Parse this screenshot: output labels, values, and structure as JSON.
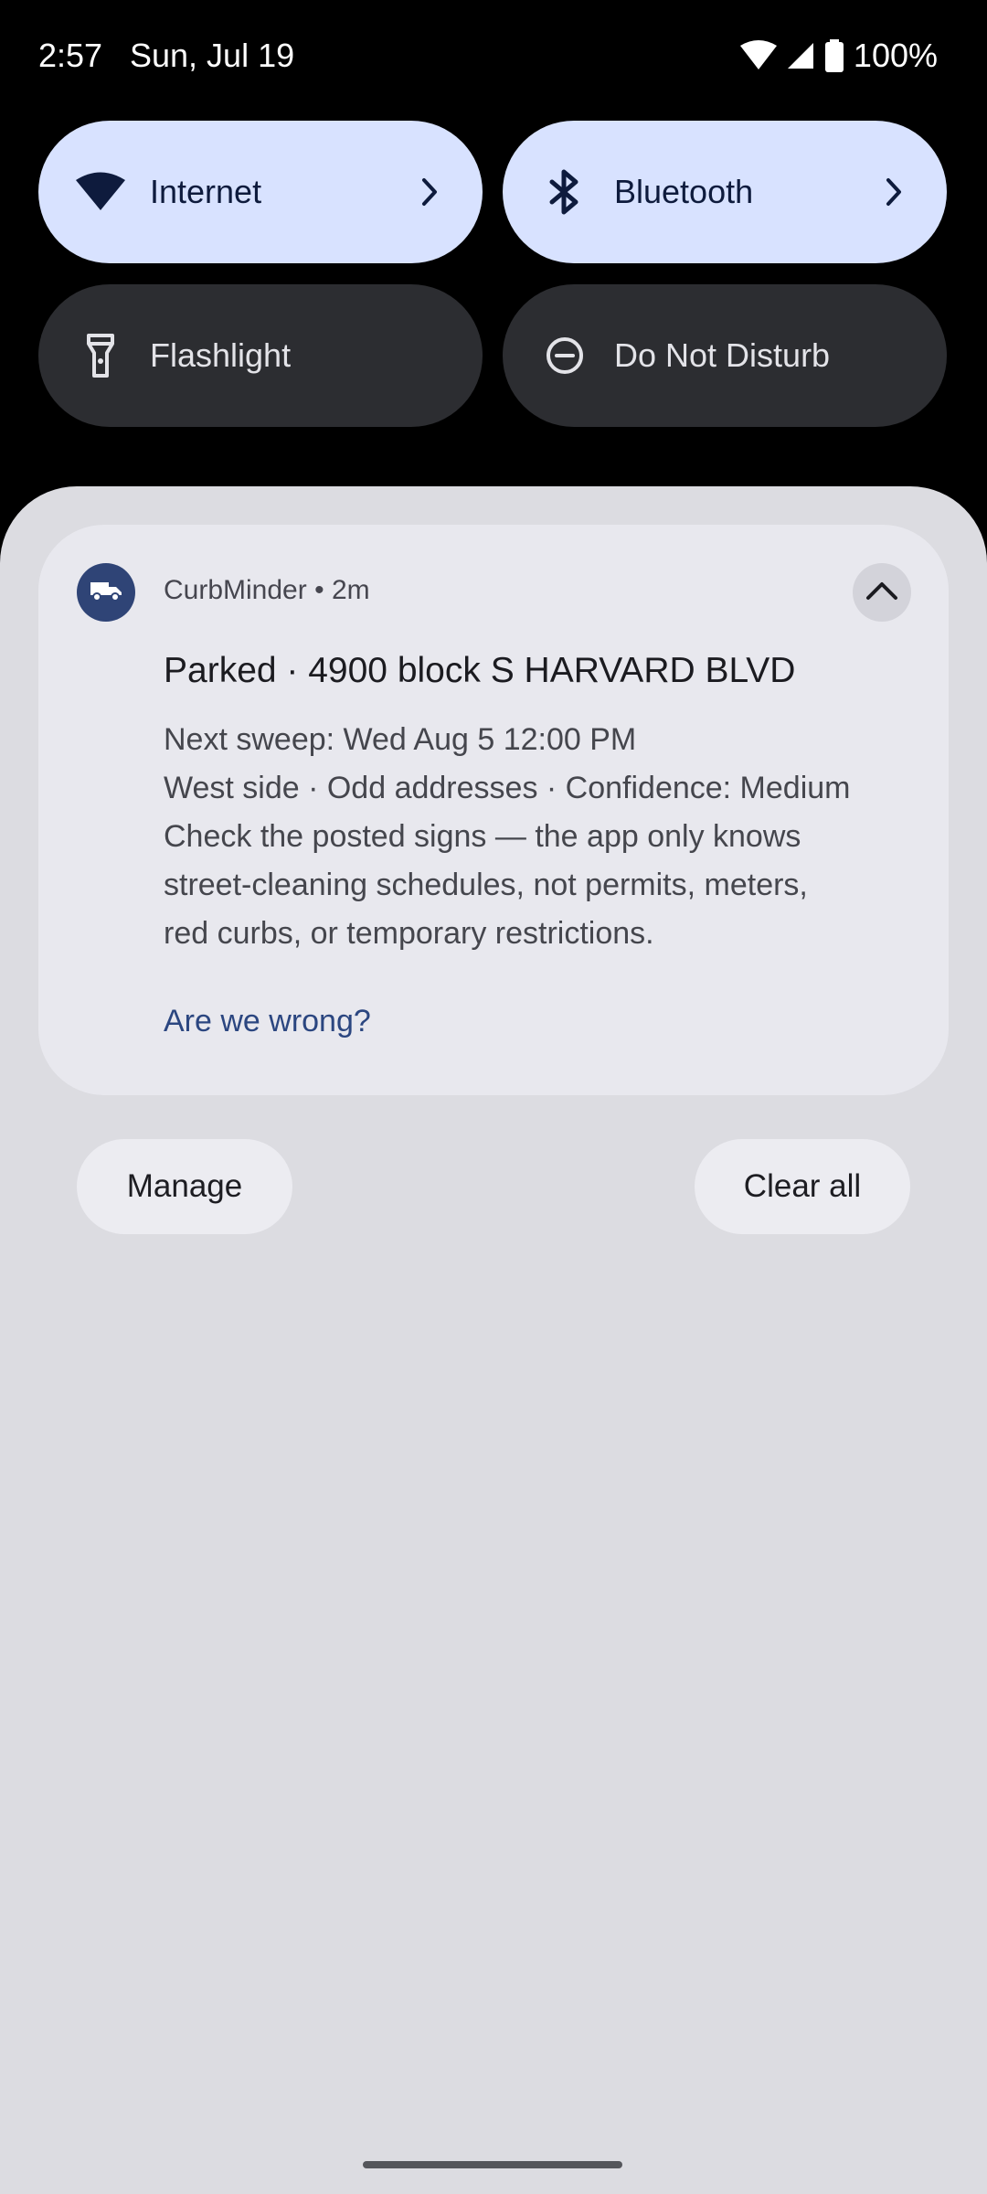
{
  "status_bar": {
    "time": "2:57",
    "date": "Sun, Jul 19",
    "battery": "100%",
    "icons": [
      "wifi-icon",
      "cell-signal-icon",
      "battery-icon"
    ]
  },
  "quick_settings": {
    "tiles": [
      {
        "label": "Internet",
        "icon": "wifi-icon",
        "state": "on",
        "has_chevron": true
      },
      {
        "label": "Bluetooth",
        "icon": "bluetooth-icon",
        "state": "on",
        "has_chevron": true
      },
      {
        "label": "Flashlight",
        "icon": "flashlight-icon",
        "state": "off",
        "has_chevron": false
      },
      {
        "label": "Do Not Disturb",
        "icon": "do-not-disturb-icon",
        "state": "off",
        "has_chevron": false
      }
    ]
  },
  "notification": {
    "app_name": "CurbMinder",
    "separator": "•",
    "age": "2m",
    "header": "CurbMinder • 2m",
    "app_icon": "truck-icon",
    "title": "Parked · 4900 block S HARVARD BLVD",
    "body_lines": [
      "Next sweep: Wed Aug 5 12:00 PM",
      "West side · Odd addresses · Confidence: Medium",
      "Check the posted signs — the app only knows",
      "street-cleaning schedules, not permits, meters,",
      "red curbs, or temporary restrictions."
    ],
    "action": "Are we wrong?",
    "expand_icon": "chevron-up-icon"
  },
  "footer": {
    "manage_label": "Manage",
    "clear_all_label": "Clear all"
  },
  "colors": {
    "accent_tile": "#d8e2ff",
    "inactive_tile": "#2c2d31",
    "shade": "#dcdce1",
    "card": "#e8e8ee",
    "link": "#2b4680",
    "app_icon_bg": "#2f4476"
  }
}
